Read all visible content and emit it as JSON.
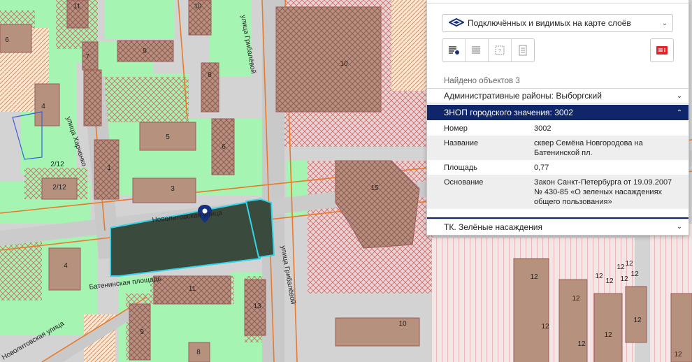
{
  "map": {
    "building_numbers": [
      "11",
      "10",
      "6",
      "7",
      "9",
      "8",
      "10",
      "4",
      "5",
      "6",
      "1",
      "2/12",
      "2/12",
      "3",
      "15",
      "4",
      "11",
      "13",
      "9",
      "8",
      "10",
      "12",
      "12",
      "12",
      "12",
      "12",
      "12",
      "12",
      "12",
      "12",
      "12",
      "12",
      "12",
      "12"
    ],
    "street_names": {
      "gribalevoy_top": "улица Грибалёвой",
      "kharchenko": "улица Харченко",
      "novolitovskaya_top": "Новолитовская улица",
      "batenin_square": "Батенинская площадь",
      "gribalevoy_bottom": "улица Грибалёвой",
      "novolitovskaya_bottom": "Новолитовская улица"
    },
    "colors": {
      "green": "#a5f4b2",
      "road": "#c7c7c7",
      "building": "#b6917d",
      "selected": "#3a4a3c",
      "orange_line": "#e9792b",
      "cyan": "#31d6e8"
    }
  },
  "panel": {
    "layer_select_value": "Подключённых и видимых на карте слоёв",
    "found_text": "Найдено объектов 3",
    "sections": [
      {
        "title": "Административные районы: Выборгский"
      },
      {
        "title": "ЗНОП городского значения: 3002"
      },
      {
        "title": "ТК. Зелёные насаждения"
      }
    ],
    "details": [
      {
        "key": "Номер",
        "value": "3002"
      },
      {
        "key": "Название",
        "value": "сквер Семёна Новгородова на Батенинской пл."
      },
      {
        "key": "Площадь",
        "value": "0,77"
      },
      {
        "key": "Основание",
        "value": "Закон Санкт-Петербурга от 19.09.2007 № 430-85 «О зеленых насаждениях общего пользования»"
      }
    ],
    "icons": {
      "layers": "layers-icon",
      "tools": [
        "list-pin-icon",
        "list-icon",
        "bbox-icon",
        "document-icon"
      ],
      "report": "report-icon"
    }
  }
}
